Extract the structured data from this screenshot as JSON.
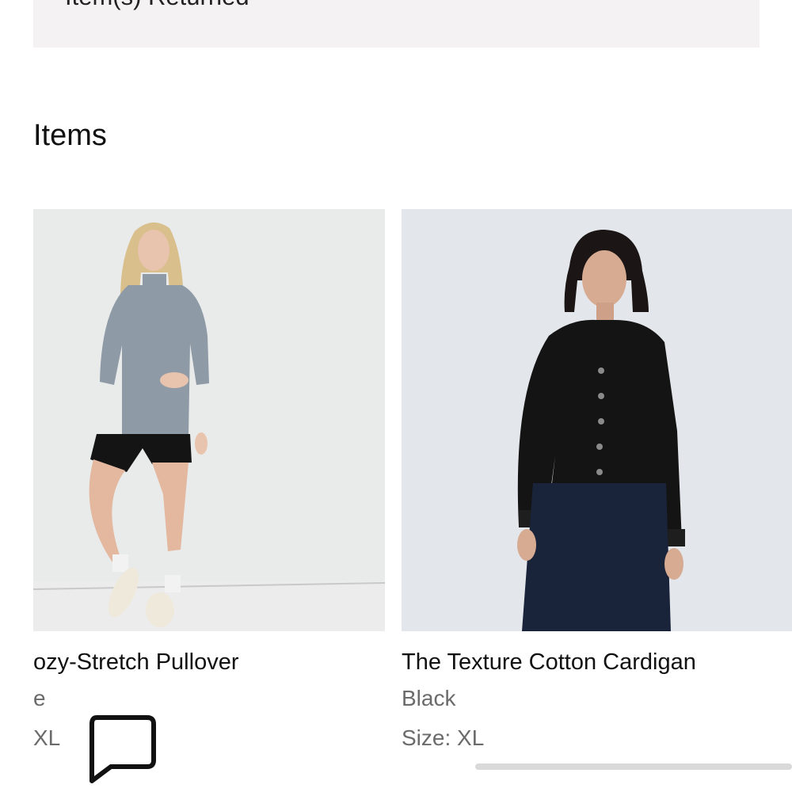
{
  "status_box": {
    "text": "Item(s) Returned"
  },
  "section": {
    "title": "Items"
  },
  "items": [
    {
      "name": "ozy-Stretch Pullover",
      "color": "e",
      "size": "XL"
    },
    {
      "name": "The Texture Cotton Cardigan",
      "color": "Black",
      "size": "Size: XL"
    }
  ],
  "icons": {
    "chat": "chat-bubble-icon"
  },
  "colors": {
    "status_bg": "#f4f2f2",
    "image_bg_left": "#e9eaea",
    "image_bg_right": "#e3e6ea",
    "secondary_text": "#6b6b6b"
  }
}
